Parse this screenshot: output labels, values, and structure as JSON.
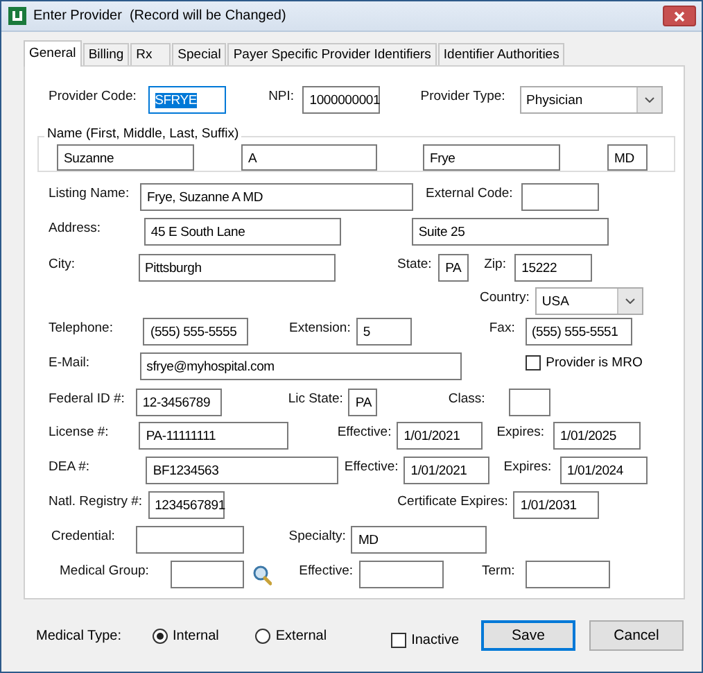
{
  "window": {
    "title": "Enter Provider  (Record will be Changed)"
  },
  "tabs": [
    {
      "label": "General",
      "selected": true
    },
    {
      "label": "Billing",
      "selected": false
    },
    {
      "label": "Rx",
      "selected": false
    },
    {
      "label": "Special",
      "selected": false
    },
    {
      "label": "Payer Specific Provider Identifiers",
      "selected": false
    },
    {
      "label": "Identifier Authorities",
      "selected": false
    }
  ],
  "form": {
    "rows": [
      {
        "items": [
          {
            "kind": "field",
            "label": "Provider Code:",
            "value": "SFRYE",
            "focused": true
          },
          {
            "kind": "field",
            "label": "NPI:",
            "value": "1000000001",
            "focused": false
          },
          {
            "kind": "combo",
            "label": "Provider Type:",
            "value": "Physician"
          }
        ]
      },
      {
        "legend": "Name (First, Middle, Last, Suffix)",
        "items": [
          {
            "kind": "field",
            "value": "Suzanne",
            "focused": false
          },
          {
            "kind": "field",
            "value": "A",
            "focused": false
          },
          {
            "kind": "field",
            "value": "Frye",
            "focused": false
          },
          {
            "kind": "field",
            "value": "MD",
            "focused": false
          }
        ]
      },
      {
        "items": [
          {
            "kind": "field",
            "label": "Listing Name:",
            "value": "Frye, Suzanne A MD",
            "focused": false
          },
          {
            "kind": "field",
            "label": "External Code:",
            "value": "",
            "focused": false
          }
        ]
      },
      {
        "items": [
          {
            "kind": "field",
            "label": "Address:",
            "value": "45 E South Lane",
            "focused": false
          },
          {
            "kind": "field",
            "value": "Suite 25",
            "focused": false
          }
        ]
      },
      {
        "items": [
          {
            "kind": "field",
            "label": "City:",
            "value": "Pittsburgh",
            "focused": false
          },
          {
            "kind": "field",
            "label": "State:",
            "value": "PA",
            "focused": false
          },
          {
            "kind": "field",
            "label": "Zip:",
            "value": "15222",
            "focused": false
          }
        ]
      },
      {
        "items": [
          {
            "kind": "combo",
            "label": "Country:",
            "value": "USA"
          }
        ]
      },
      {
        "items": [
          {
            "kind": "field",
            "label": "Telephone:",
            "value": "(555) 555-5555",
            "focused": false
          },
          {
            "kind": "field",
            "label": "Extension:",
            "value": "5",
            "focused": false
          },
          {
            "kind": "field",
            "label": "Fax:",
            "value": "(555) 555-5551",
            "focused": false
          }
        ]
      },
      {
        "items": [
          {
            "kind": "field",
            "label": "E-Mail:",
            "value": "sfrye@myhospital.com",
            "focused": false
          },
          {
            "kind": "checkbox",
            "label": "Provider is MRO",
            "checked": false
          }
        ]
      },
      {
        "items": [
          {
            "kind": "field",
            "label": "Federal ID #:",
            "value": "12-3456789",
            "focused": false
          },
          {
            "kind": "field",
            "label": "Lic State:",
            "value": "PA",
            "focused": false
          },
          {
            "kind": "field",
            "label": "Class:",
            "value": "",
            "focused": false
          }
        ]
      },
      {
        "items": [
          {
            "kind": "field",
            "label": "License #:",
            "value": "PA-11111111",
            "focused": false
          },
          {
            "kind": "field",
            "label": "Effective:",
            "value": "1/01/2021",
            "focused": false
          },
          {
            "kind": "field",
            "label": "Expires:",
            "value": "1/01/2025",
            "focused": false
          }
        ]
      },
      {
        "items": [
          {
            "kind": "field",
            "label": "DEA #:",
            "value": "BF1234563",
            "focused": false
          },
          {
            "kind": "field",
            "label": "Effective:",
            "value": "1/01/2021",
            "focused": false
          },
          {
            "kind": "field",
            "label": "Expires:",
            "value": "1/01/2024",
            "focused": false
          }
        ]
      },
      {
        "items": [
          {
            "kind": "field",
            "label": "Natl. Registry #:",
            "value": "1234567891",
            "focused": false
          },
          {
            "kind": "field",
            "label": "Certificate Expires:",
            "value": "1/01/2031",
            "focused": false
          }
        ]
      },
      {
        "items": [
          {
            "kind": "field",
            "label": "Credential:",
            "value": "",
            "focused": false
          },
          {
            "kind": "field",
            "label": "Specialty:",
            "value": "MD",
            "focused": false
          }
        ]
      },
      {
        "items": [
          {
            "kind": "field",
            "label": "Medical Group:",
            "value": "",
            "focused": false
          },
          {
            "kind": "lookup"
          },
          {
            "kind": "field",
            "label": "Effective:",
            "value": "",
            "focused": false
          },
          {
            "kind": "field",
            "label": "Term:",
            "value": "",
            "focused": false
          }
        ]
      }
    ]
  },
  "footer": {
    "medical_type": {
      "label": "Medical Type:",
      "options": [
        {
          "label": "Internal",
          "selected": true
        },
        {
          "label": "External",
          "selected": false
        }
      ]
    },
    "inactive": {
      "label": "Inactive",
      "checked": false
    },
    "buttons": [
      {
        "label": "Save",
        "default": true
      },
      {
        "label": "Cancel",
        "default": false
      }
    ]
  }
}
